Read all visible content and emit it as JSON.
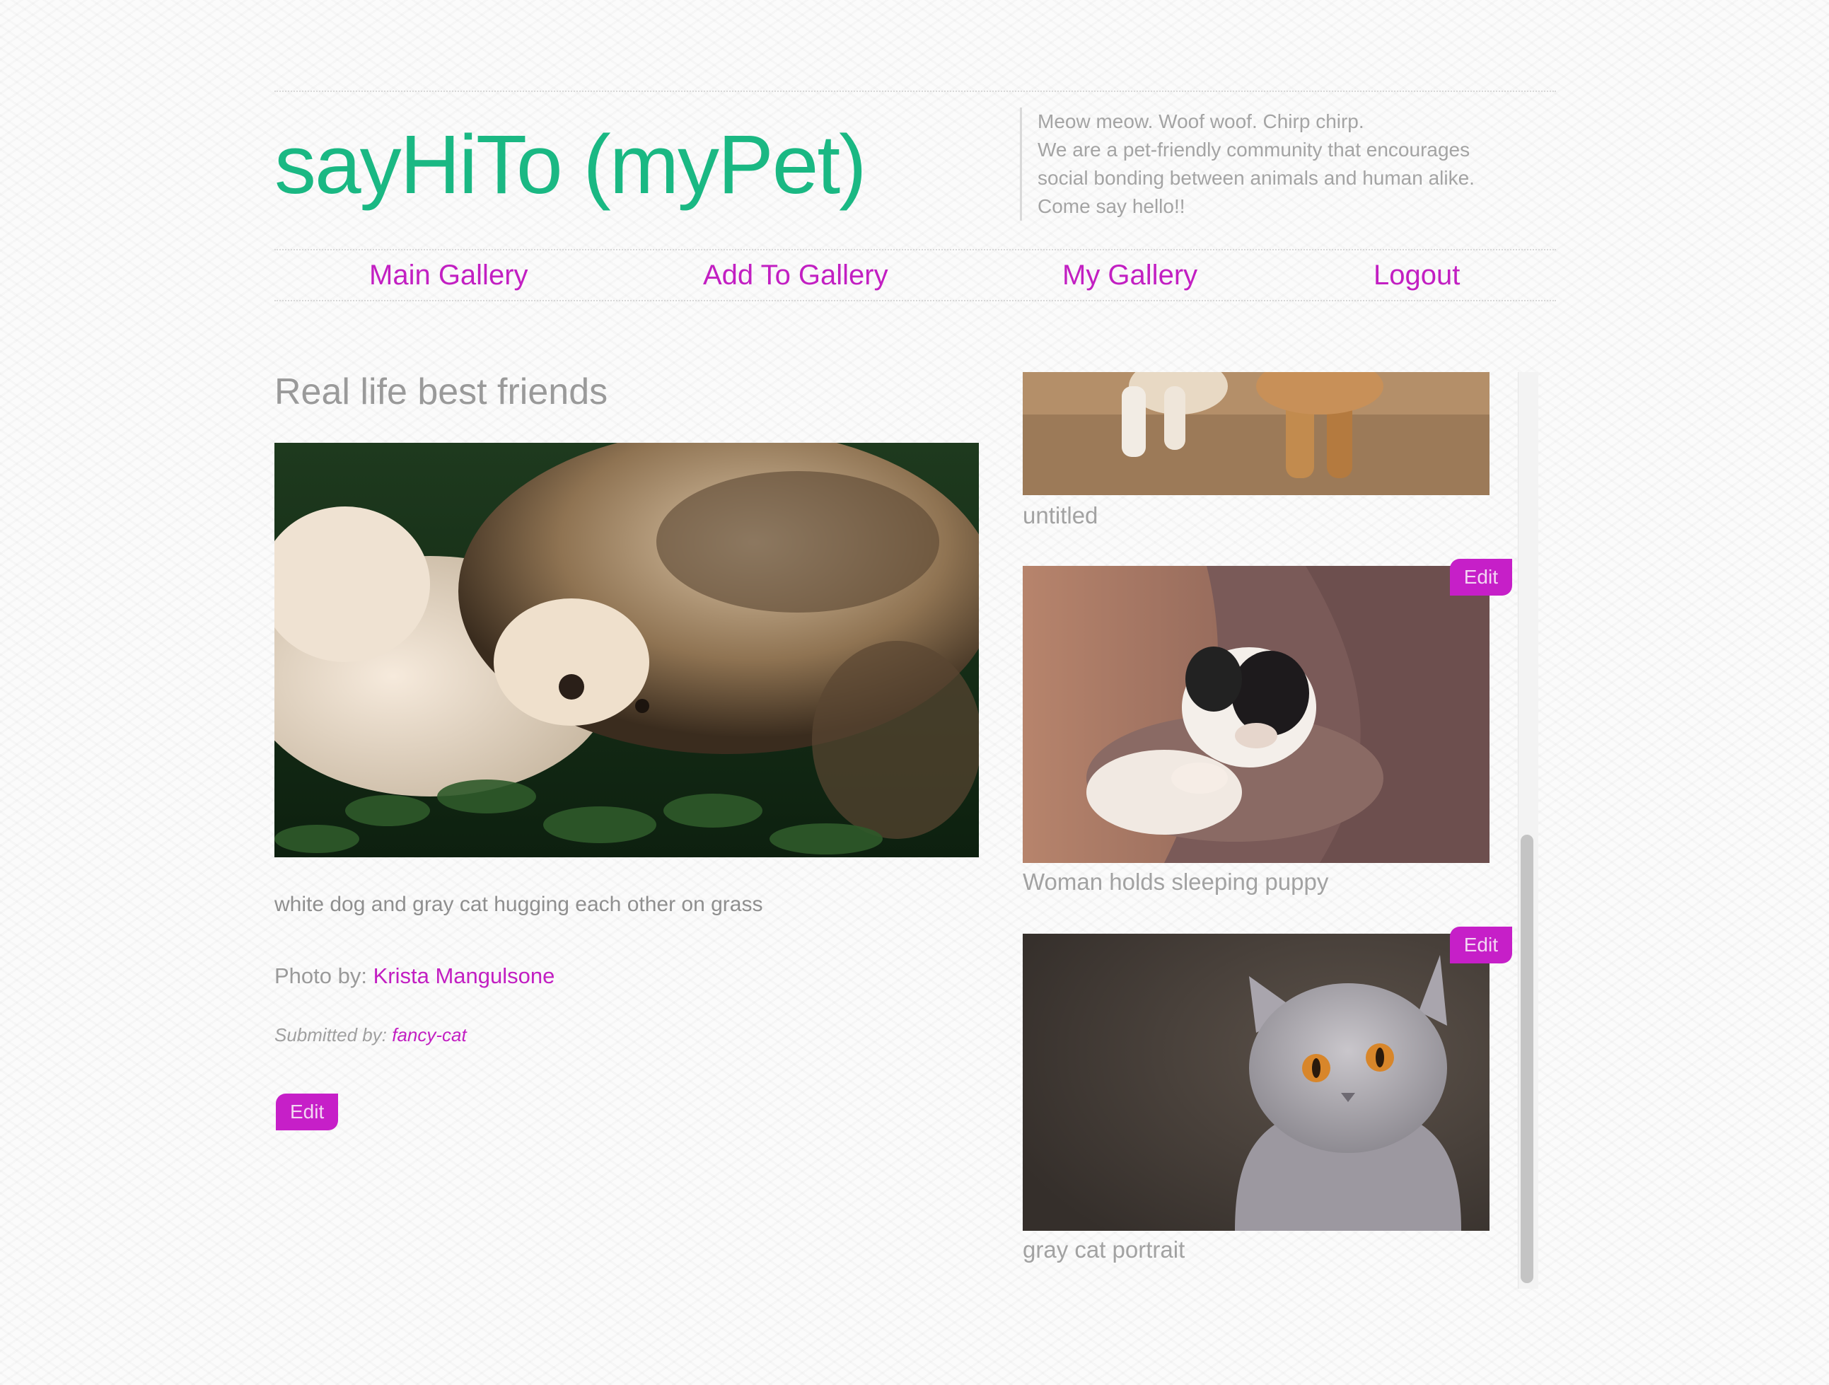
{
  "header": {
    "title": "sayHiTo (myPet)",
    "tagline": [
      "Meow meow. Woof woof. Chirp chirp.",
      "We are a pet-friendly community that encourages",
      "social bonding between animals and human alike.",
      "Come say hello!!"
    ]
  },
  "nav": {
    "items": [
      "Main Gallery",
      "Add To Gallery",
      "My Gallery",
      "Logout"
    ]
  },
  "post": {
    "title": "Real life best friends",
    "description": "white dog and gray cat hugging each other on grass",
    "photo_by_label": "Photo by:",
    "photographer": "Krista Mangulsone",
    "submitted_by_label": "Submitted by:",
    "submitter": "fancy-cat",
    "edit_label": "Edit"
  },
  "gallery": {
    "items": [
      {
        "caption": "untitled",
        "edit_label": ""
      },
      {
        "caption": "Woman holds sleeping puppy",
        "edit_label": "Edit"
      },
      {
        "caption": "gray cat portrait",
        "edit_label": "Edit"
      }
    ]
  },
  "colors": {
    "brand": "#1ab883",
    "accent": "#c21fc2",
    "muted_text": "#9a9a9a"
  }
}
